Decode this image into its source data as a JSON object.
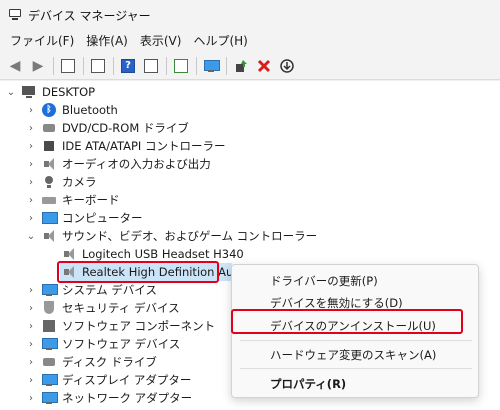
{
  "window": {
    "title": "デバイス マネージャー"
  },
  "menu": [
    {
      "label": "ファイル(F)"
    },
    {
      "label": "操作(A)"
    },
    {
      "label": "表示(V)"
    },
    {
      "label": "ヘルプ(H)"
    }
  ],
  "toolbar": {
    "help_glyph": "?"
  },
  "tree": {
    "root": "DESKTOP",
    "categories": [
      {
        "label": "Bluetooth",
        "icon": "bluetooth-icon"
      },
      {
        "label": "DVD/CD-ROM ドライブ",
        "icon": "disk-drive-icon"
      },
      {
        "label": "IDE ATA/ATAPI コントローラー",
        "icon": "controller-icon"
      },
      {
        "label": "オーディオの入力および出力",
        "icon": "speaker-icon"
      },
      {
        "label": "カメラ",
        "icon": "camera-icon"
      },
      {
        "label": "キーボード",
        "icon": "keyboard-icon"
      },
      {
        "label": "コンピューター",
        "icon": "computer-icon"
      },
      {
        "label": "サウンド、ビデオ、およびゲーム コントローラー",
        "icon": "speaker-icon",
        "expanded": true
      },
      {
        "label": "システム デバイス",
        "icon": "monitor-icon"
      },
      {
        "label": "セキュリティ デバイス",
        "icon": "security-icon"
      },
      {
        "label": "ソフトウェア コンポーネント",
        "icon": "puzzle-icon"
      },
      {
        "label": "ソフトウェア デバイス",
        "icon": "monitor-icon"
      },
      {
        "label": "ディスク ドライブ",
        "icon": "disk-drive-icon"
      },
      {
        "label": "ディスプレイ アダプター",
        "icon": "monitor-icon"
      },
      {
        "label": "ネットワーク アダプター",
        "icon": "monitor-icon"
      }
    ],
    "children": [
      {
        "label": "Logitech USB Headset H340",
        "icon": "speaker-icon"
      },
      {
        "label": "Realtek High Definition Audi",
        "icon": "speaker-icon",
        "selected": true
      }
    ]
  },
  "context_menu": {
    "items": [
      {
        "label": "ドライバーの更新(P)"
      },
      {
        "label": "デバイスを無効にする(D)"
      },
      {
        "label": "デバイスのアンインストール(U)",
        "highlighted": true
      },
      {
        "label": "ハードウェア変更のスキャン(A)"
      },
      {
        "label": "プロパティ(R)",
        "bold": true
      }
    ]
  },
  "colors": {
    "highlight_border": "#e3001b",
    "selection": "#cce4f7"
  }
}
